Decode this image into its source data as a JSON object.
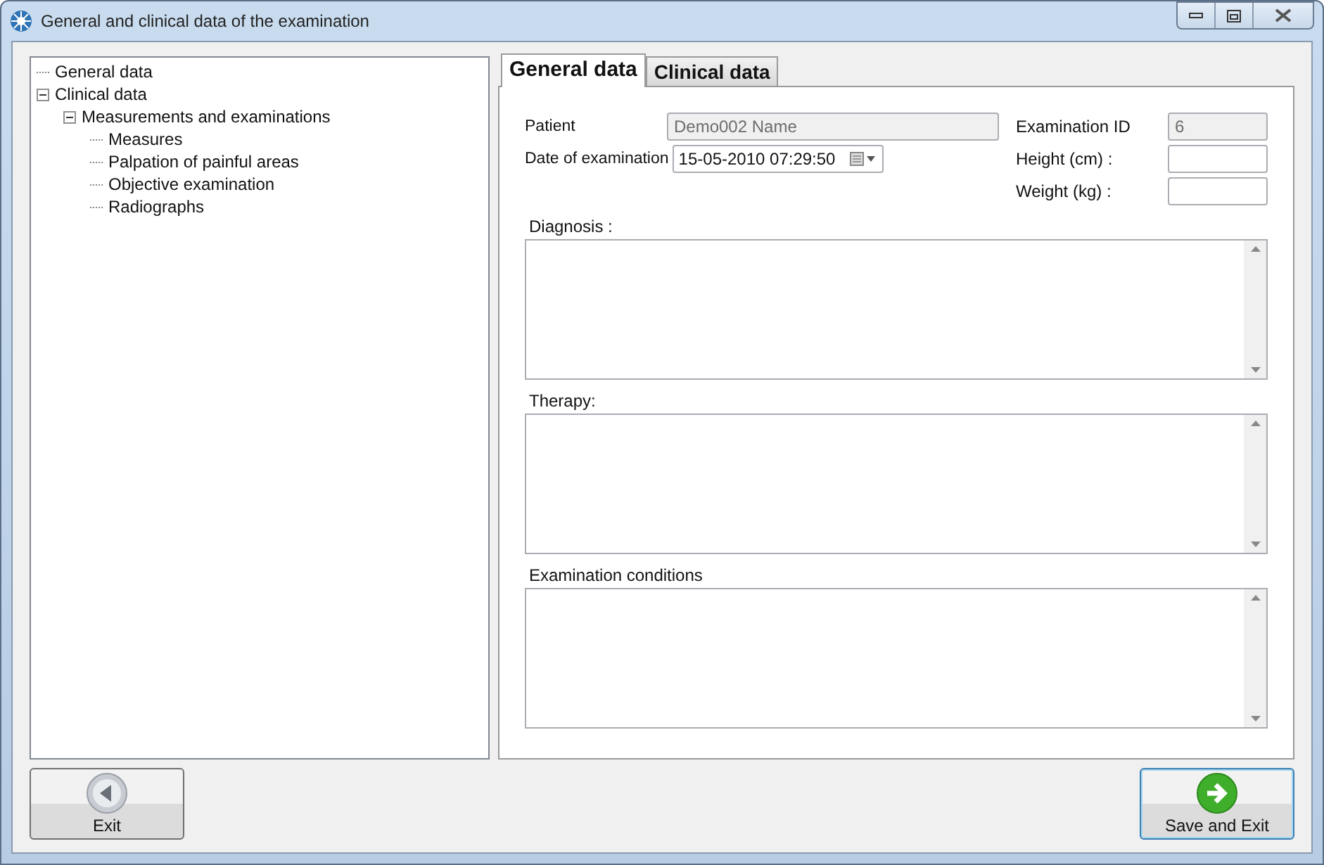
{
  "window": {
    "title": "General and clinical data of the examination"
  },
  "tree": [
    {
      "label": "General data"
    },
    {
      "label": "Clinical data",
      "expanded": true,
      "children": [
        {
          "label": "Measurements and examinations",
          "expanded": true,
          "children": [
            {
              "label": "Measures"
            },
            {
              "label": "Palpation of painful areas"
            },
            {
              "label": "Objective examination"
            },
            {
              "label": "Radiographs"
            }
          ]
        }
      ]
    }
  ],
  "tabs": [
    {
      "label": "General data",
      "selected": true
    },
    {
      "label": "Clinical data",
      "selected": false
    }
  ],
  "fields": {
    "patient": {
      "label": "Patient",
      "value": "Demo002 Name",
      "disabled": true
    },
    "date": {
      "label": "Date of examination",
      "value": "15-05-2010 07:29:50"
    },
    "examination_id": {
      "label": "Examination ID",
      "value": "6",
      "disabled": true
    },
    "height": {
      "label": "Height (cm) :"
    },
    "weight": {
      "label": "Weight (kg) :"
    }
  },
  "text_areas": [
    {
      "label": "Diagnosis :"
    },
    {
      "label": "Therapy:"
    },
    {
      "label": "Examination conditions"
    }
  ],
  "buttons": [
    {
      "label": "Exit",
      "kind": "back"
    },
    {
      "label": "Save and Exit",
      "kind": "save"
    }
  ]
}
